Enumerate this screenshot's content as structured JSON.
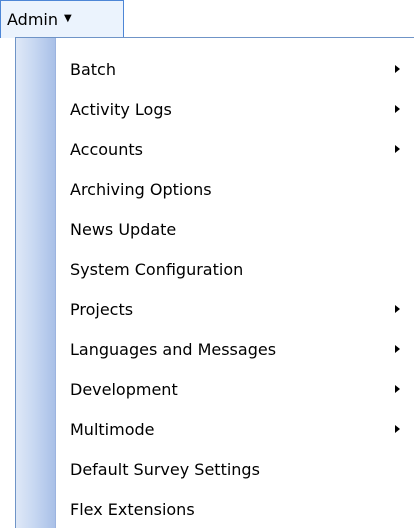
{
  "menubar": {
    "admin_label": "Admin",
    "caret": "▼"
  },
  "menu": {
    "items": [
      {
        "label": "Batch",
        "has_submenu": true
      },
      {
        "label": "Activity Logs",
        "has_submenu": true
      },
      {
        "label": "Accounts",
        "has_submenu": true
      },
      {
        "label": "Archiving Options",
        "has_submenu": false
      },
      {
        "label": "News Update",
        "has_submenu": false
      },
      {
        "label": "System Configuration",
        "has_submenu": false
      },
      {
        "label": "Projects",
        "has_submenu": true
      },
      {
        "label": "Languages and Messages",
        "has_submenu": true
      },
      {
        "label": "Development",
        "has_submenu": true
      },
      {
        "label": "Multimode",
        "has_submenu": true
      },
      {
        "label": "Default Survey Settings",
        "has_submenu": false
      },
      {
        "label": "Flex Extensions",
        "has_submenu": false
      }
    ]
  },
  "icons": {
    "caret": "chevron-down-icon",
    "submenu": "chevron-right-icon"
  },
  "colors": {
    "menubar_bg": "#ebf3fd",
    "menubar_border": "#4d86d6",
    "gutter_start": "#dfe8f7",
    "gutter_end": "#a9c0e7",
    "panel_border": "#6f94c7"
  }
}
